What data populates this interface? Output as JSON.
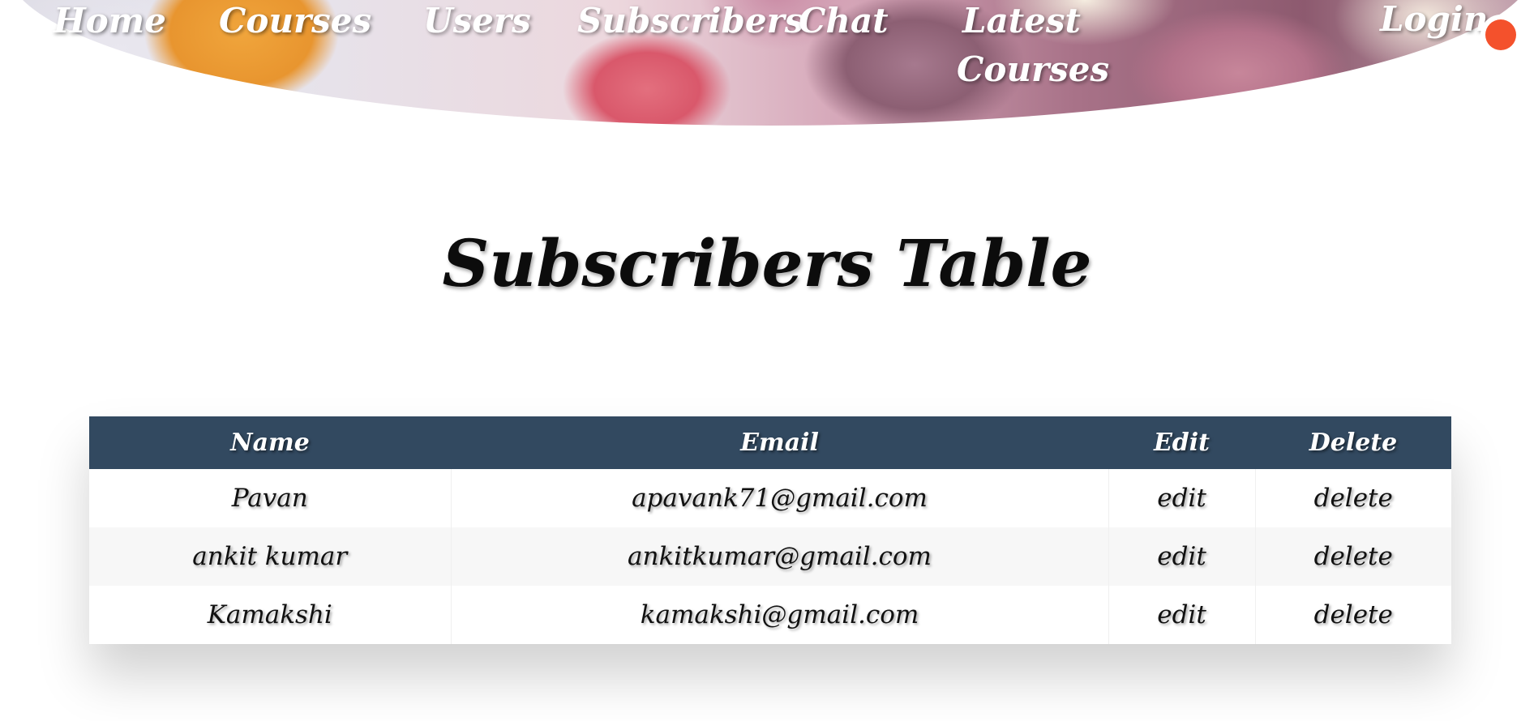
{
  "nav": {
    "home": "Home",
    "courses": "Courses",
    "users": "Users",
    "subscribers": "Subscribers",
    "chat": "Chat",
    "latest_line1": "Latest",
    "latest_line2": "Courses",
    "login": "Login"
  },
  "title": "Subscribers Table",
  "table": {
    "headers": {
      "name": "Name",
      "email": "Email",
      "edit": "Edit",
      "delete": "Delete"
    },
    "rows": [
      {
        "name": "Pavan",
        "email": "apavank71@gmail.com",
        "edit": "edit",
        "delete": "delete"
      },
      {
        "name": "ankit kumar",
        "email": "ankitkumar@gmail.com",
        "edit": "edit",
        "delete": "delete"
      },
      {
        "name": "Kamakshi",
        "email": "kamakshi@gmail.com",
        "edit": "edit",
        "delete": "delete"
      }
    ]
  },
  "colors": {
    "header_bg": "#324960",
    "notification_dot": "#f4512c"
  }
}
